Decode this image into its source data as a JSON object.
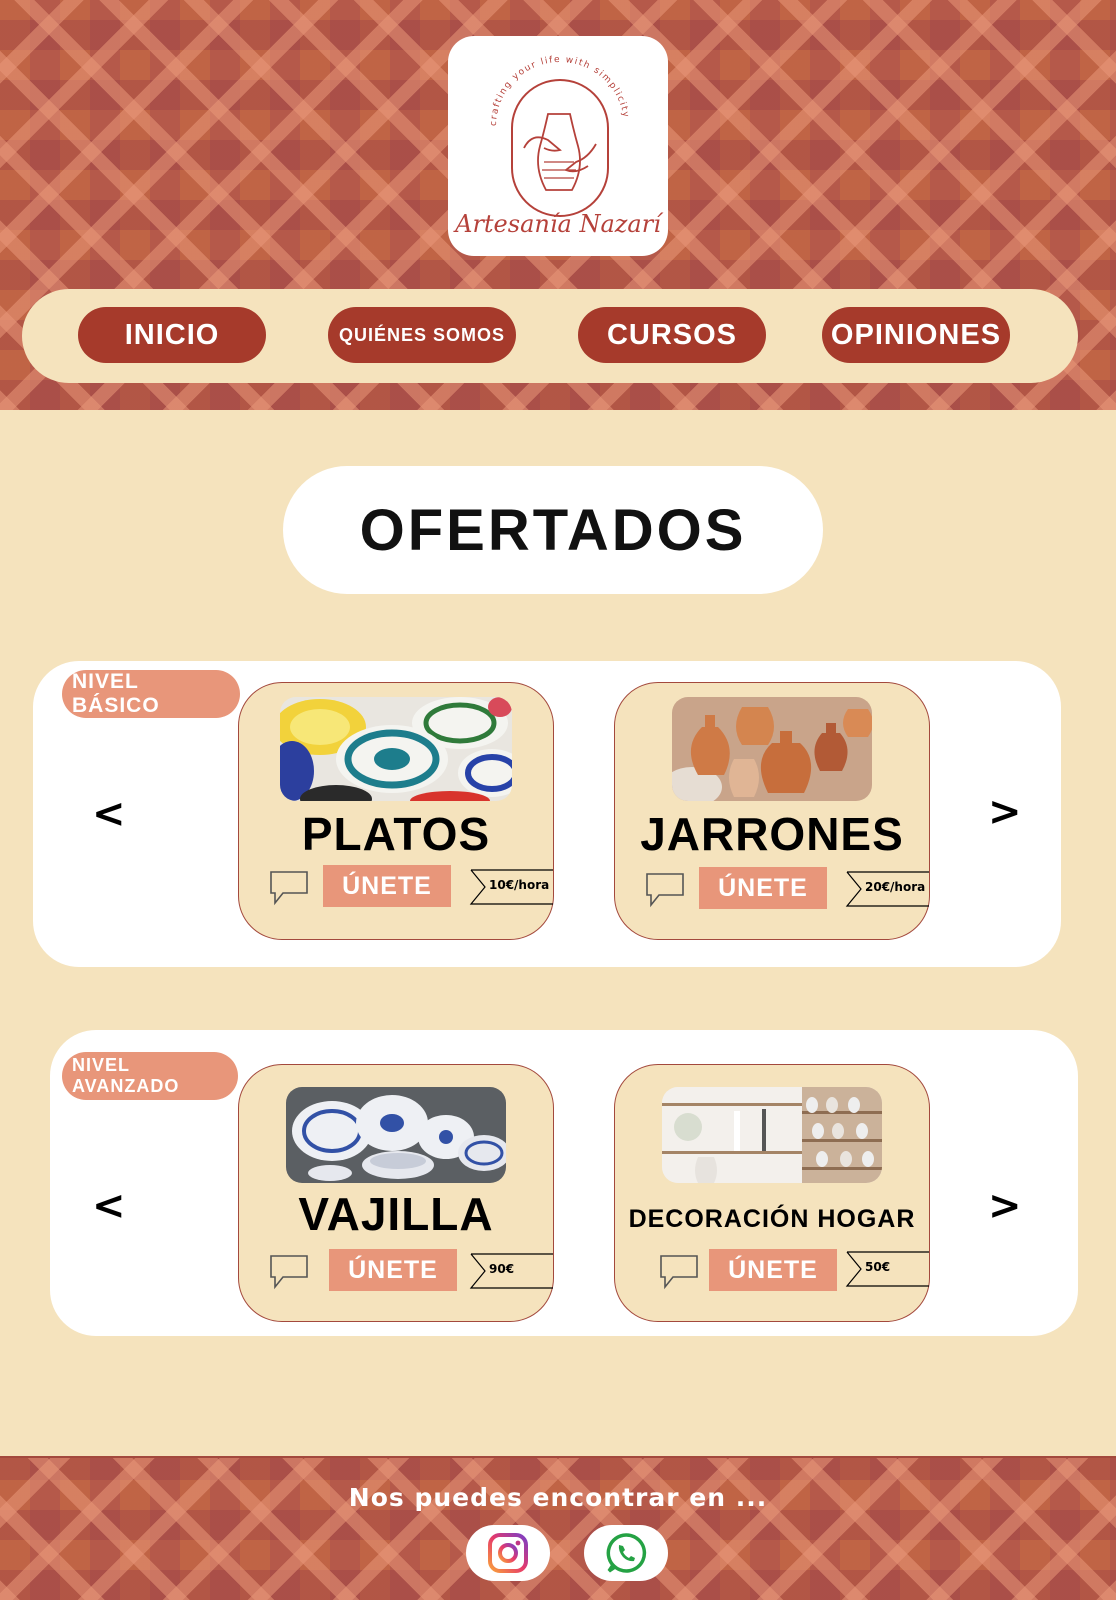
{
  "brand": {
    "name": "Artesanía Nazarí",
    "tagline": "crafting your life with simplicity"
  },
  "nav": {
    "items": [
      {
        "label": "INICIO"
      },
      {
        "label": "QUIÉNES SOMOS"
      },
      {
        "label": "CURSOS"
      },
      {
        "label": "OPINIONES"
      }
    ]
  },
  "main": {
    "title": "OFERTADOS",
    "levels": [
      {
        "label": "NIVEL BÁSICO",
        "courses": [
          {
            "title": "PLATOS",
            "join_label": "ÚNETE",
            "price": "10€/hora"
          },
          {
            "title": "JARRONES",
            "join_label": "ÚNETE",
            "price": "20€/hora"
          }
        ]
      },
      {
        "label": "NIVEL AVANZADO",
        "courses": [
          {
            "title": "VAJILLA",
            "join_label": "ÚNETE",
            "price": "90€"
          },
          {
            "title": "DECORACIÓN HOGAR",
            "join_label": "ÚNETE",
            "price": "50€"
          }
        ]
      }
    ],
    "prev_arrow": "<",
    "next_arrow": ">"
  },
  "footer": {
    "text": "Nos puedes encontrar en ...",
    "social": [
      "instagram-icon",
      "whatsapp-icon"
    ]
  },
  "colors": {
    "brand_red": "#a63a2b",
    "accent_salmon": "#e8967a",
    "cream": "#f5e3bd",
    "logo_red": "#b5413a"
  }
}
